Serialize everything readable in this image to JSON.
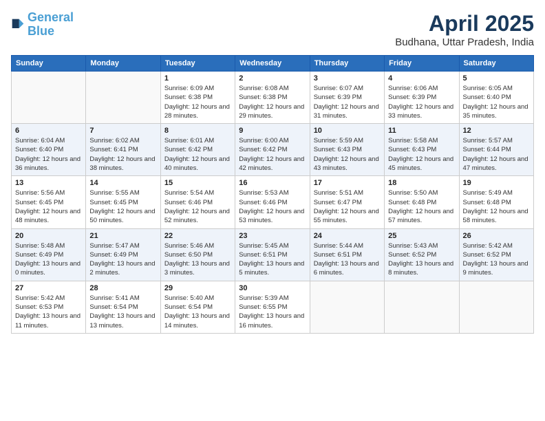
{
  "header": {
    "logo_line1": "General",
    "logo_line2": "Blue",
    "title": "April 2025",
    "subtitle": "Budhana, Uttar Pradesh, India"
  },
  "columns": [
    "Sunday",
    "Monday",
    "Tuesday",
    "Wednesday",
    "Thursday",
    "Friday",
    "Saturday"
  ],
  "weeks": [
    {
      "days": [
        {
          "num": "",
          "info": ""
        },
        {
          "num": "",
          "info": ""
        },
        {
          "num": "1",
          "info": "Sunrise: 6:09 AM\nSunset: 6:38 PM\nDaylight: 12 hours and 28 minutes."
        },
        {
          "num": "2",
          "info": "Sunrise: 6:08 AM\nSunset: 6:38 PM\nDaylight: 12 hours and 29 minutes."
        },
        {
          "num": "3",
          "info": "Sunrise: 6:07 AM\nSunset: 6:39 PM\nDaylight: 12 hours and 31 minutes."
        },
        {
          "num": "4",
          "info": "Sunrise: 6:06 AM\nSunset: 6:39 PM\nDaylight: 12 hours and 33 minutes."
        },
        {
          "num": "5",
          "info": "Sunrise: 6:05 AM\nSunset: 6:40 PM\nDaylight: 12 hours and 35 minutes."
        }
      ]
    },
    {
      "days": [
        {
          "num": "6",
          "info": "Sunrise: 6:04 AM\nSunset: 6:40 PM\nDaylight: 12 hours and 36 minutes."
        },
        {
          "num": "7",
          "info": "Sunrise: 6:02 AM\nSunset: 6:41 PM\nDaylight: 12 hours and 38 minutes."
        },
        {
          "num": "8",
          "info": "Sunrise: 6:01 AM\nSunset: 6:42 PM\nDaylight: 12 hours and 40 minutes."
        },
        {
          "num": "9",
          "info": "Sunrise: 6:00 AM\nSunset: 6:42 PM\nDaylight: 12 hours and 42 minutes."
        },
        {
          "num": "10",
          "info": "Sunrise: 5:59 AM\nSunset: 6:43 PM\nDaylight: 12 hours and 43 minutes."
        },
        {
          "num": "11",
          "info": "Sunrise: 5:58 AM\nSunset: 6:43 PM\nDaylight: 12 hours and 45 minutes."
        },
        {
          "num": "12",
          "info": "Sunrise: 5:57 AM\nSunset: 6:44 PM\nDaylight: 12 hours and 47 minutes."
        }
      ]
    },
    {
      "days": [
        {
          "num": "13",
          "info": "Sunrise: 5:56 AM\nSunset: 6:45 PM\nDaylight: 12 hours and 48 minutes."
        },
        {
          "num": "14",
          "info": "Sunrise: 5:55 AM\nSunset: 6:45 PM\nDaylight: 12 hours and 50 minutes."
        },
        {
          "num": "15",
          "info": "Sunrise: 5:54 AM\nSunset: 6:46 PM\nDaylight: 12 hours and 52 minutes."
        },
        {
          "num": "16",
          "info": "Sunrise: 5:53 AM\nSunset: 6:46 PM\nDaylight: 12 hours and 53 minutes."
        },
        {
          "num": "17",
          "info": "Sunrise: 5:51 AM\nSunset: 6:47 PM\nDaylight: 12 hours and 55 minutes."
        },
        {
          "num": "18",
          "info": "Sunrise: 5:50 AM\nSunset: 6:48 PM\nDaylight: 12 hours and 57 minutes."
        },
        {
          "num": "19",
          "info": "Sunrise: 5:49 AM\nSunset: 6:48 PM\nDaylight: 12 hours and 58 minutes."
        }
      ]
    },
    {
      "days": [
        {
          "num": "20",
          "info": "Sunrise: 5:48 AM\nSunset: 6:49 PM\nDaylight: 13 hours and 0 minutes."
        },
        {
          "num": "21",
          "info": "Sunrise: 5:47 AM\nSunset: 6:49 PM\nDaylight: 13 hours and 2 minutes."
        },
        {
          "num": "22",
          "info": "Sunrise: 5:46 AM\nSunset: 6:50 PM\nDaylight: 13 hours and 3 minutes."
        },
        {
          "num": "23",
          "info": "Sunrise: 5:45 AM\nSunset: 6:51 PM\nDaylight: 13 hours and 5 minutes."
        },
        {
          "num": "24",
          "info": "Sunrise: 5:44 AM\nSunset: 6:51 PM\nDaylight: 13 hours and 6 minutes."
        },
        {
          "num": "25",
          "info": "Sunrise: 5:43 AM\nSunset: 6:52 PM\nDaylight: 13 hours and 8 minutes."
        },
        {
          "num": "26",
          "info": "Sunrise: 5:42 AM\nSunset: 6:52 PM\nDaylight: 13 hours and 9 minutes."
        }
      ]
    },
    {
      "days": [
        {
          "num": "27",
          "info": "Sunrise: 5:42 AM\nSunset: 6:53 PM\nDaylight: 13 hours and 11 minutes."
        },
        {
          "num": "28",
          "info": "Sunrise: 5:41 AM\nSunset: 6:54 PM\nDaylight: 13 hours and 13 minutes."
        },
        {
          "num": "29",
          "info": "Sunrise: 5:40 AM\nSunset: 6:54 PM\nDaylight: 13 hours and 14 minutes."
        },
        {
          "num": "30",
          "info": "Sunrise: 5:39 AM\nSunset: 6:55 PM\nDaylight: 13 hours and 16 minutes."
        },
        {
          "num": "",
          "info": ""
        },
        {
          "num": "",
          "info": ""
        },
        {
          "num": "",
          "info": ""
        }
      ]
    }
  ]
}
